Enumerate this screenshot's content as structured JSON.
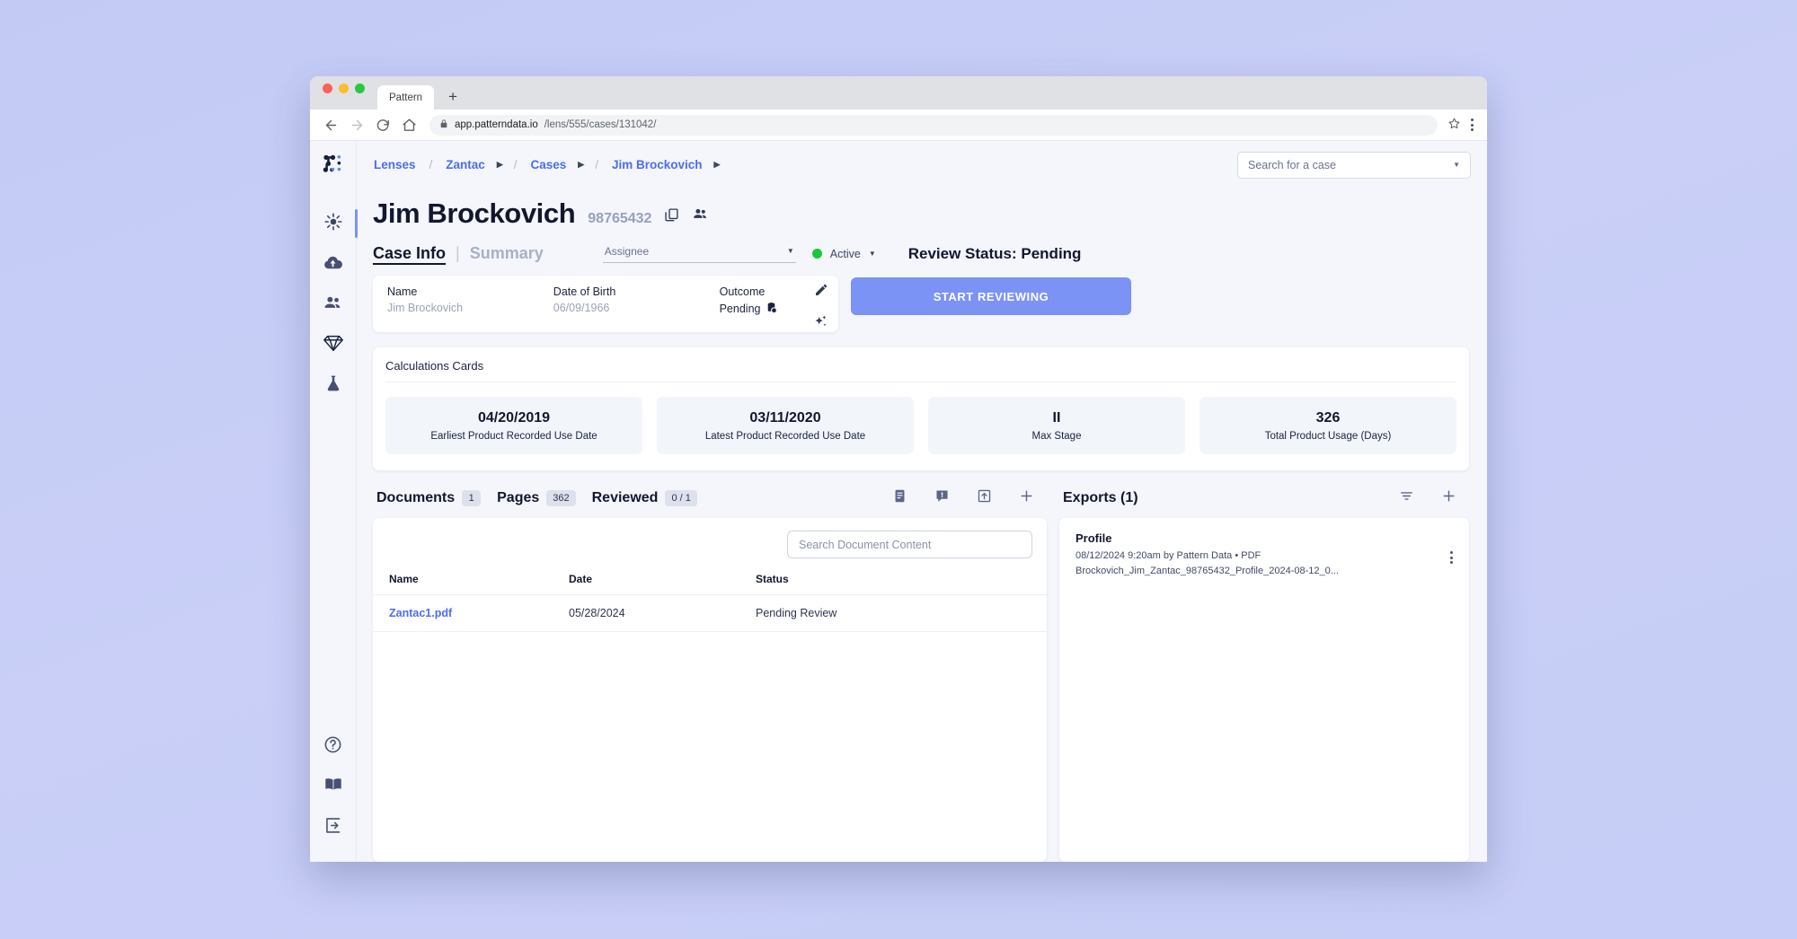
{
  "browser": {
    "tab_title": "Pattern",
    "new_tab_label": "+",
    "url_domain": "app.patterndata.io",
    "url_path": "/lens/555/cases/131042/"
  },
  "sidebar": {
    "items": [
      {
        "name": "insights",
        "icon": "sparkle-burst-icon"
      },
      {
        "name": "uploads",
        "icon": "cloud-upload-icon"
      },
      {
        "name": "people",
        "icon": "people-icon"
      },
      {
        "name": "lenses",
        "icon": "diamond-icon"
      },
      {
        "name": "lab",
        "icon": "flask-icon"
      }
    ],
    "bottom_items": [
      {
        "name": "help",
        "icon": "question-circle-icon"
      },
      {
        "name": "docs",
        "icon": "book-icon"
      },
      {
        "name": "logout",
        "icon": "logout-icon"
      }
    ]
  },
  "breadcrumb": {
    "items": [
      "Lenses",
      "Zantac",
      "Cases",
      "Jim Brockovich"
    ],
    "separator": "/"
  },
  "search": {
    "placeholder": "Search for a case"
  },
  "case": {
    "name": "Jim Brockovich",
    "id": "98765432",
    "tabs": [
      {
        "label": "Case Info",
        "active": true
      },
      {
        "label": "Summary",
        "active": false
      }
    ],
    "assignee_placeholder": "Assignee",
    "status": "Active",
    "status_color": "#18c93c",
    "review_status": "Review Status: Pending",
    "start_review_label": "START REVIEWING",
    "fields": [
      {
        "label": "Name",
        "value": "Jim Brockovich"
      },
      {
        "label": "Date of Birth",
        "value": "06/09/1966"
      },
      {
        "label": "Outcome",
        "value": "Pending"
      }
    ]
  },
  "calculations": {
    "title": "Calculations Cards",
    "cards": [
      {
        "value": "04/20/2019",
        "label": "Earliest Product Recorded Use Date"
      },
      {
        "value": "03/11/2020",
        "label": "Latest Product Recorded Use Date"
      },
      {
        "value": "II",
        "label": "Max Stage"
      },
      {
        "value": "326",
        "label": "Total Product Usage (Days)"
      }
    ]
  },
  "documents": {
    "header": [
      {
        "label": "Documents",
        "count": "1"
      },
      {
        "label": "Pages",
        "count": "362"
      },
      {
        "label": "Reviewed",
        "count": "0 / 1"
      }
    ],
    "search_placeholder": "Search Document Content",
    "columns": [
      "Name",
      "Date",
      "Status"
    ],
    "rows": [
      {
        "name": "Zantac1.pdf",
        "date": "05/28/2024",
        "status": "Pending Review"
      }
    ]
  },
  "exports": {
    "title": "Exports (1)",
    "items": [
      {
        "title": "Profile",
        "meta": "08/12/2024 9:20am by Pattern Data • PDF",
        "filename": "Brockovich_Jim_Zantac_98765432_Profile_2024-08-12_0..."
      }
    ]
  },
  "colors": {
    "accent_blue": "#4a6cf7",
    "button_blue": "#7b93f5",
    "status_green": "#18c93c",
    "page_bg": "#f4f6fb"
  }
}
